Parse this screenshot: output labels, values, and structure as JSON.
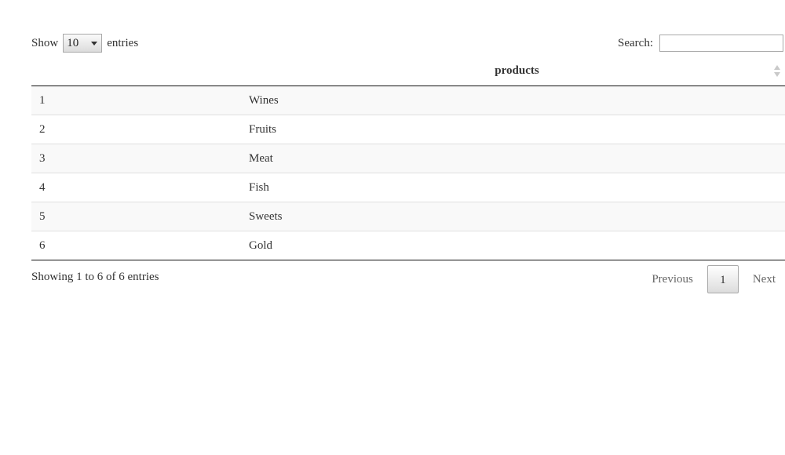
{
  "length_menu": {
    "show_label": "Show",
    "selected": "10",
    "entries_label": "entries"
  },
  "search": {
    "label": "Search:",
    "value": ""
  },
  "table": {
    "columns": [
      "",
      "products"
    ],
    "rows": [
      {
        "index": "1",
        "product": "Wines"
      },
      {
        "index": "2",
        "product": "Fruits"
      },
      {
        "index": "3",
        "product": "Meat"
      },
      {
        "index": "4",
        "product": "Fish"
      },
      {
        "index": "5",
        "product": "Sweets"
      },
      {
        "index": "6",
        "product": "Gold"
      }
    ]
  },
  "info": {
    "text": "Showing 1 to 6 of 6 entries"
  },
  "pagination": {
    "previous": "Previous",
    "current": "1",
    "next": "Next"
  }
}
